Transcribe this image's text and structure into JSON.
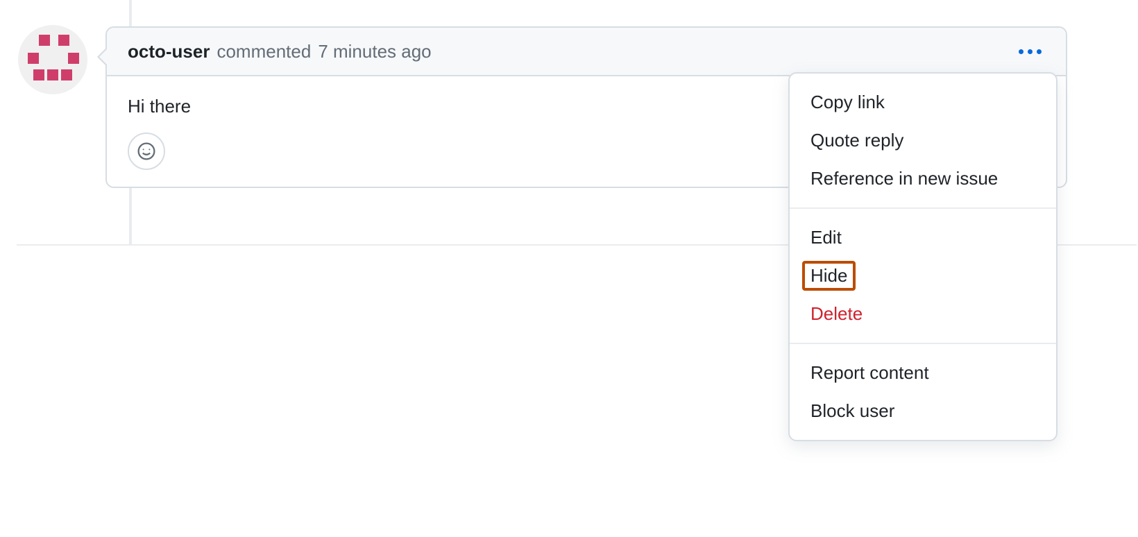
{
  "comment": {
    "author": "octo-user",
    "action_text": "commented",
    "timestamp": "7 minutes ago",
    "body": "Hi there"
  },
  "menu": {
    "copy_link": "Copy link",
    "quote_reply": "Quote reply",
    "reference_issue": "Reference in new issue",
    "edit": "Edit",
    "hide": "Hide",
    "delete": "Delete",
    "report": "Report content",
    "block": "Block user"
  }
}
